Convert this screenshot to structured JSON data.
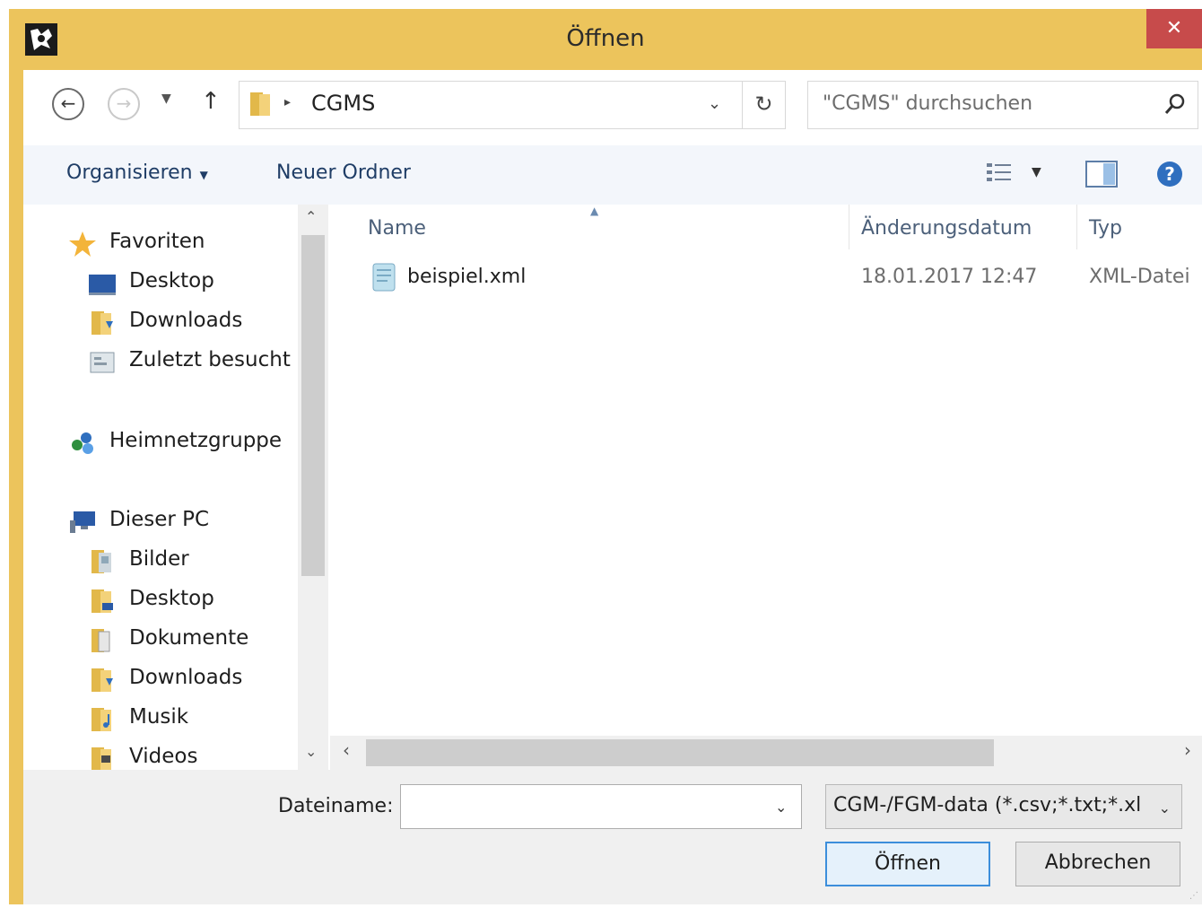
{
  "window": {
    "title": "Öffnen",
    "close_label": "✕",
    "frame_color": "#ecc45c"
  },
  "address": {
    "breadcrumb_separator": "▸",
    "current_folder": "CGMS",
    "search_placeholder": "\"CGMS\" durchsuchen"
  },
  "toolbar": {
    "organize_label": "Organisieren",
    "new_folder_label": "Neuer Ordner"
  },
  "nav": {
    "favorites": "Favoriten",
    "desktop": "Desktop",
    "downloads": "Downloads",
    "recent": "Zuletzt besucht",
    "homegroup": "Heimnetzgruppe",
    "this_pc": "Dieser PC",
    "pictures": "Bilder",
    "pc_desktop": "Desktop",
    "documents": "Dokumente",
    "pc_downloads": "Downloads",
    "music": "Musik",
    "videos": "Videos"
  },
  "columns": {
    "name": "Name",
    "date": "Änderungsdatum",
    "type": "Typ"
  },
  "files": [
    {
      "name": "beispiel.xml",
      "date": "18.01.2017 12:47",
      "type": "XML-Datei"
    }
  ],
  "bottom": {
    "filename_label": "Dateiname:",
    "filename_value": "",
    "filetype_value": "CGM-/FGM-data (*.csv;*.txt;*.xl",
    "open_label": "Öffnen",
    "cancel_label": "Abbrechen"
  }
}
